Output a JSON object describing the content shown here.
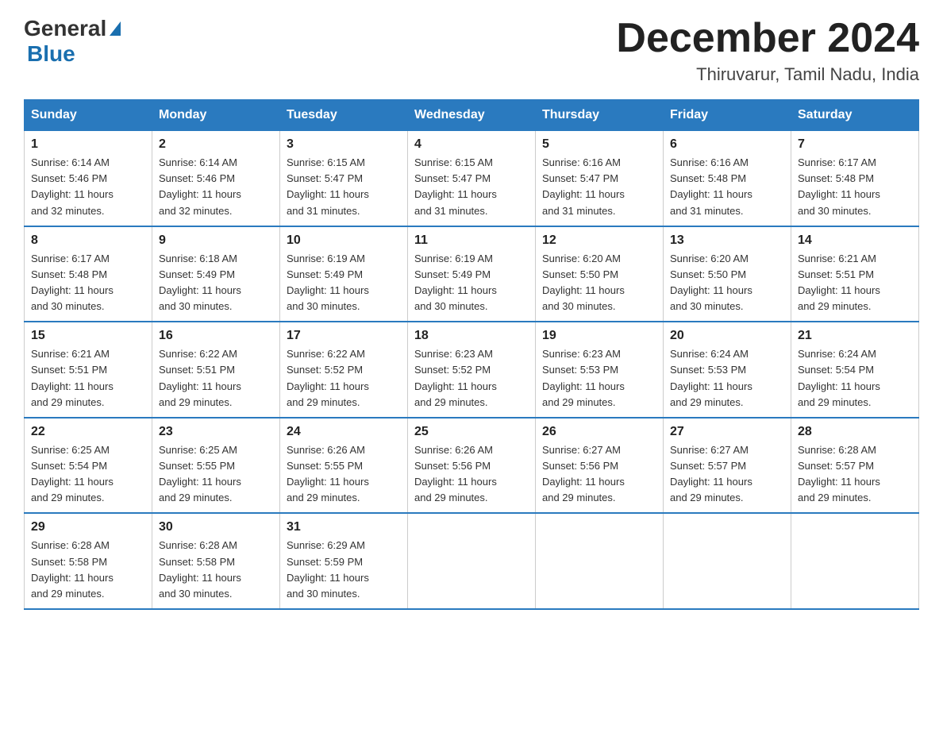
{
  "logo": {
    "text_general": "General",
    "text_blue": "Blue",
    "triangle_symbol": "▲"
  },
  "title": {
    "month": "December 2024",
    "location": "Thiruvarur, Tamil Nadu, India"
  },
  "headers": [
    "Sunday",
    "Monday",
    "Tuesday",
    "Wednesday",
    "Thursday",
    "Friday",
    "Saturday"
  ],
  "weeks": [
    [
      {
        "day": "1",
        "sunrise": "6:14 AM",
        "sunset": "5:46 PM",
        "daylight": "11 hours and 32 minutes."
      },
      {
        "day": "2",
        "sunrise": "6:14 AM",
        "sunset": "5:46 PM",
        "daylight": "11 hours and 32 minutes."
      },
      {
        "day": "3",
        "sunrise": "6:15 AM",
        "sunset": "5:47 PM",
        "daylight": "11 hours and 31 minutes."
      },
      {
        "day": "4",
        "sunrise": "6:15 AM",
        "sunset": "5:47 PM",
        "daylight": "11 hours and 31 minutes."
      },
      {
        "day": "5",
        "sunrise": "6:16 AM",
        "sunset": "5:47 PM",
        "daylight": "11 hours and 31 minutes."
      },
      {
        "day": "6",
        "sunrise": "6:16 AM",
        "sunset": "5:48 PM",
        "daylight": "11 hours and 31 minutes."
      },
      {
        "day": "7",
        "sunrise": "6:17 AM",
        "sunset": "5:48 PM",
        "daylight": "11 hours and 30 minutes."
      }
    ],
    [
      {
        "day": "8",
        "sunrise": "6:17 AM",
        "sunset": "5:48 PM",
        "daylight": "11 hours and 30 minutes."
      },
      {
        "day": "9",
        "sunrise": "6:18 AM",
        "sunset": "5:49 PM",
        "daylight": "11 hours and 30 minutes."
      },
      {
        "day": "10",
        "sunrise": "6:19 AM",
        "sunset": "5:49 PM",
        "daylight": "11 hours and 30 minutes."
      },
      {
        "day": "11",
        "sunrise": "6:19 AM",
        "sunset": "5:49 PM",
        "daylight": "11 hours and 30 minutes."
      },
      {
        "day": "12",
        "sunrise": "6:20 AM",
        "sunset": "5:50 PM",
        "daylight": "11 hours and 30 minutes."
      },
      {
        "day": "13",
        "sunrise": "6:20 AM",
        "sunset": "5:50 PM",
        "daylight": "11 hours and 30 minutes."
      },
      {
        "day": "14",
        "sunrise": "6:21 AM",
        "sunset": "5:51 PM",
        "daylight": "11 hours and 29 minutes."
      }
    ],
    [
      {
        "day": "15",
        "sunrise": "6:21 AM",
        "sunset": "5:51 PM",
        "daylight": "11 hours and 29 minutes."
      },
      {
        "day": "16",
        "sunrise": "6:22 AM",
        "sunset": "5:51 PM",
        "daylight": "11 hours and 29 minutes."
      },
      {
        "day": "17",
        "sunrise": "6:22 AM",
        "sunset": "5:52 PM",
        "daylight": "11 hours and 29 minutes."
      },
      {
        "day": "18",
        "sunrise": "6:23 AM",
        "sunset": "5:52 PM",
        "daylight": "11 hours and 29 minutes."
      },
      {
        "day": "19",
        "sunrise": "6:23 AM",
        "sunset": "5:53 PM",
        "daylight": "11 hours and 29 minutes."
      },
      {
        "day": "20",
        "sunrise": "6:24 AM",
        "sunset": "5:53 PM",
        "daylight": "11 hours and 29 minutes."
      },
      {
        "day": "21",
        "sunrise": "6:24 AM",
        "sunset": "5:54 PM",
        "daylight": "11 hours and 29 minutes."
      }
    ],
    [
      {
        "day": "22",
        "sunrise": "6:25 AM",
        "sunset": "5:54 PM",
        "daylight": "11 hours and 29 minutes."
      },
      {
        "day": "23",
        "sunrise": "6:25 AM",
        "sunset": "5:55 PM",
        "daylight": "11 hours and 29 minutes."
      },
      {
        "day": "24",
        "sunrise": "6:26 AM",
        "sunset": "5:55 PM",
        "daylight": "11 hours and 29 minutes."
      },
      {
        "day": "25",
        "sunrise": "6:26 AM",
        "sunset": "5:56 PM",
        "daylight": "11 hours and 29 minutes."
      },
      {
        "day": "26",
        "sunrise": "6:27 AM",
        "sunset": "5:56 PM",
        "daylight": "11 hours and 29 minutes."
      },
      {
        "day": "27",
        "sunrise": "6:27 AM",
        "sunset": "5:57 PM",
        "daylight": "11 hours and 29 minutes."
      },
      {
        "day": "28",
        "sunrise": "6:28 AM",
        "sunset": "5:57 PM",
        "daylight": "11 hours and 29 minutes."
      }
    ],
    [
      {
        "day": "29",
        "sunrise": "6:28 AM",
        "sunset": "5:58 PM",
        "daylight": "11 hours and 29 minutes."
      },
      {
        "day": "30",
        "sunrise": "6:28 AM",
        "sunset": "5:58 PM",
        "daylight": "11 hours and 30 minutes."
      },
      {
        "day": "31",
        "sunrise": "6:29 AM",
        "sunset": "5:59 PM",
        "daylight": "11 hours and 30 minutes."
      },
      null,
      null,
      null,
      null
    ]
  ],
  "labels": {
    "sunrise": "Sunrise:",
    "sunset": "Sunset:",
    "daylight": "Daylight:"
  }
}
